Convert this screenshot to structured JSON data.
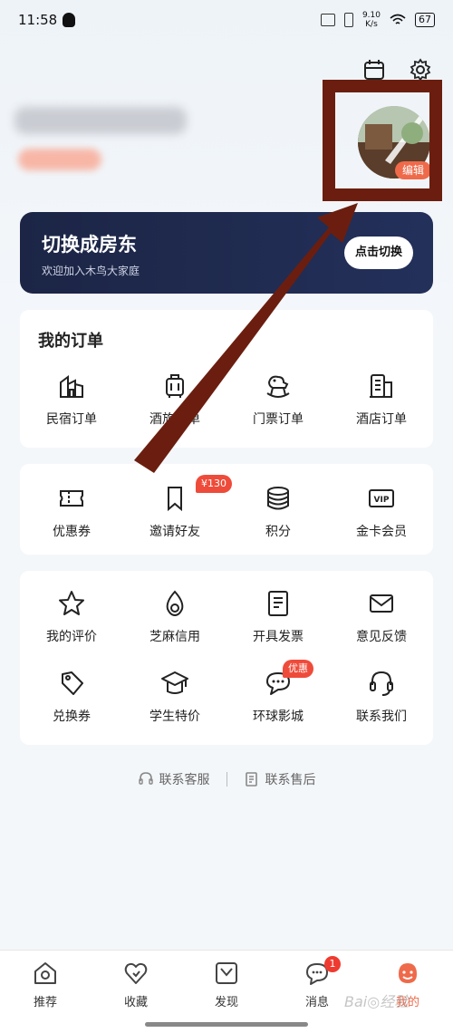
{
  "status_bar": {
    "time": "11:58",
    "net_speed_value": "9.10",
    "net_speed_unit": "K/s",
    "battery": "67"
  },
  "profile": {
    "avatar_edit_label": "编辑"
  },
  "landlord_banner": {
    "title": "切换成房东",
    "subtitle": "欢迎加入木鸟大家庭",
    "button_label": "点击切换"
  },
  "orders": {
    "title": "我的订单",
    "items": [
      {
        "label": "民宿订单",
        "icon": "homestay-order-icon"
      },
      {
        "label": "酒旅订单",
        "icon": "luggage-icon"
      },
      {
        "label": "门票订单",
        "icon": "rocking-horse-icon"
      },
      {
        "label": "酒店订单",
        "icon": "hotel-building-icon"
      }
    ]
  },
  "benefits": {
    "items": [
      {
        "label": "优惠券",
        "icon": "coupon-icon"
      },
      {
        "label": "邀请好友",
        "icon": "bookmark-icon",
        "badge": "¥130"
      },
      {
        "label": "积分",
        "icon": "coin-stack-icon"
      },
      {
        "label": "金卡会员",
        "icon": "vip-card-icon",
        "icon_text": "VIP"
      }
    ]
  },
  "tools": {
    "items": [
      {
        "label": "我的评价",
        "icon": "star-icon"
      },
      {
        "label": "芝麻信用",
        "icon": "sesame-icon"
      },
      {
        "label": "开具发票",
        "icon": "invoice-icon"
      },
      {
        "label": "意见反馈",
        "icon": "mail-icon"
      },
      {
        "label": "兑换券",
        "icon": "tag-icon"
      },
      {
        "label": "学生特价",
        "icon": "graduation-cap-icon"
      },
      {
        "label": "环球影城",
        "icon": "chat-bubble-icon",
        "badge": "优惠"
      },
      {
        "label": "联系我们",
        "icon": "headset-icon"
      }
    ]
  },
  "service_links": {
    "customer_service": "联系客服",
    "after_sales": "联系售后"
  },
  "tabbar": {
    "items": [
      {
        "label": "推荐",
        "icon": "home-icon"
      },
      {
        "label": "收藏",
        "icon": "heart-icon"
      },
      {
        "label": "发现",
        "icon": "discover-icon"
      },
      {
        "label": "消息",
        "icon": "message-icon",
        "badge": "1"
      },
      {
        "label": "我的",
        "icon": "profile-face-icon",
        "active": true
      }
    ]
  },
  "watermark": "Bai◎经验",
  "colors": {
    "accent": "#ef6a4a",
    "banner_bg": "#1c2545",
    "badge_red": "#ef4b3a",
    "annotation": "#6b1e0f"
  }
}
